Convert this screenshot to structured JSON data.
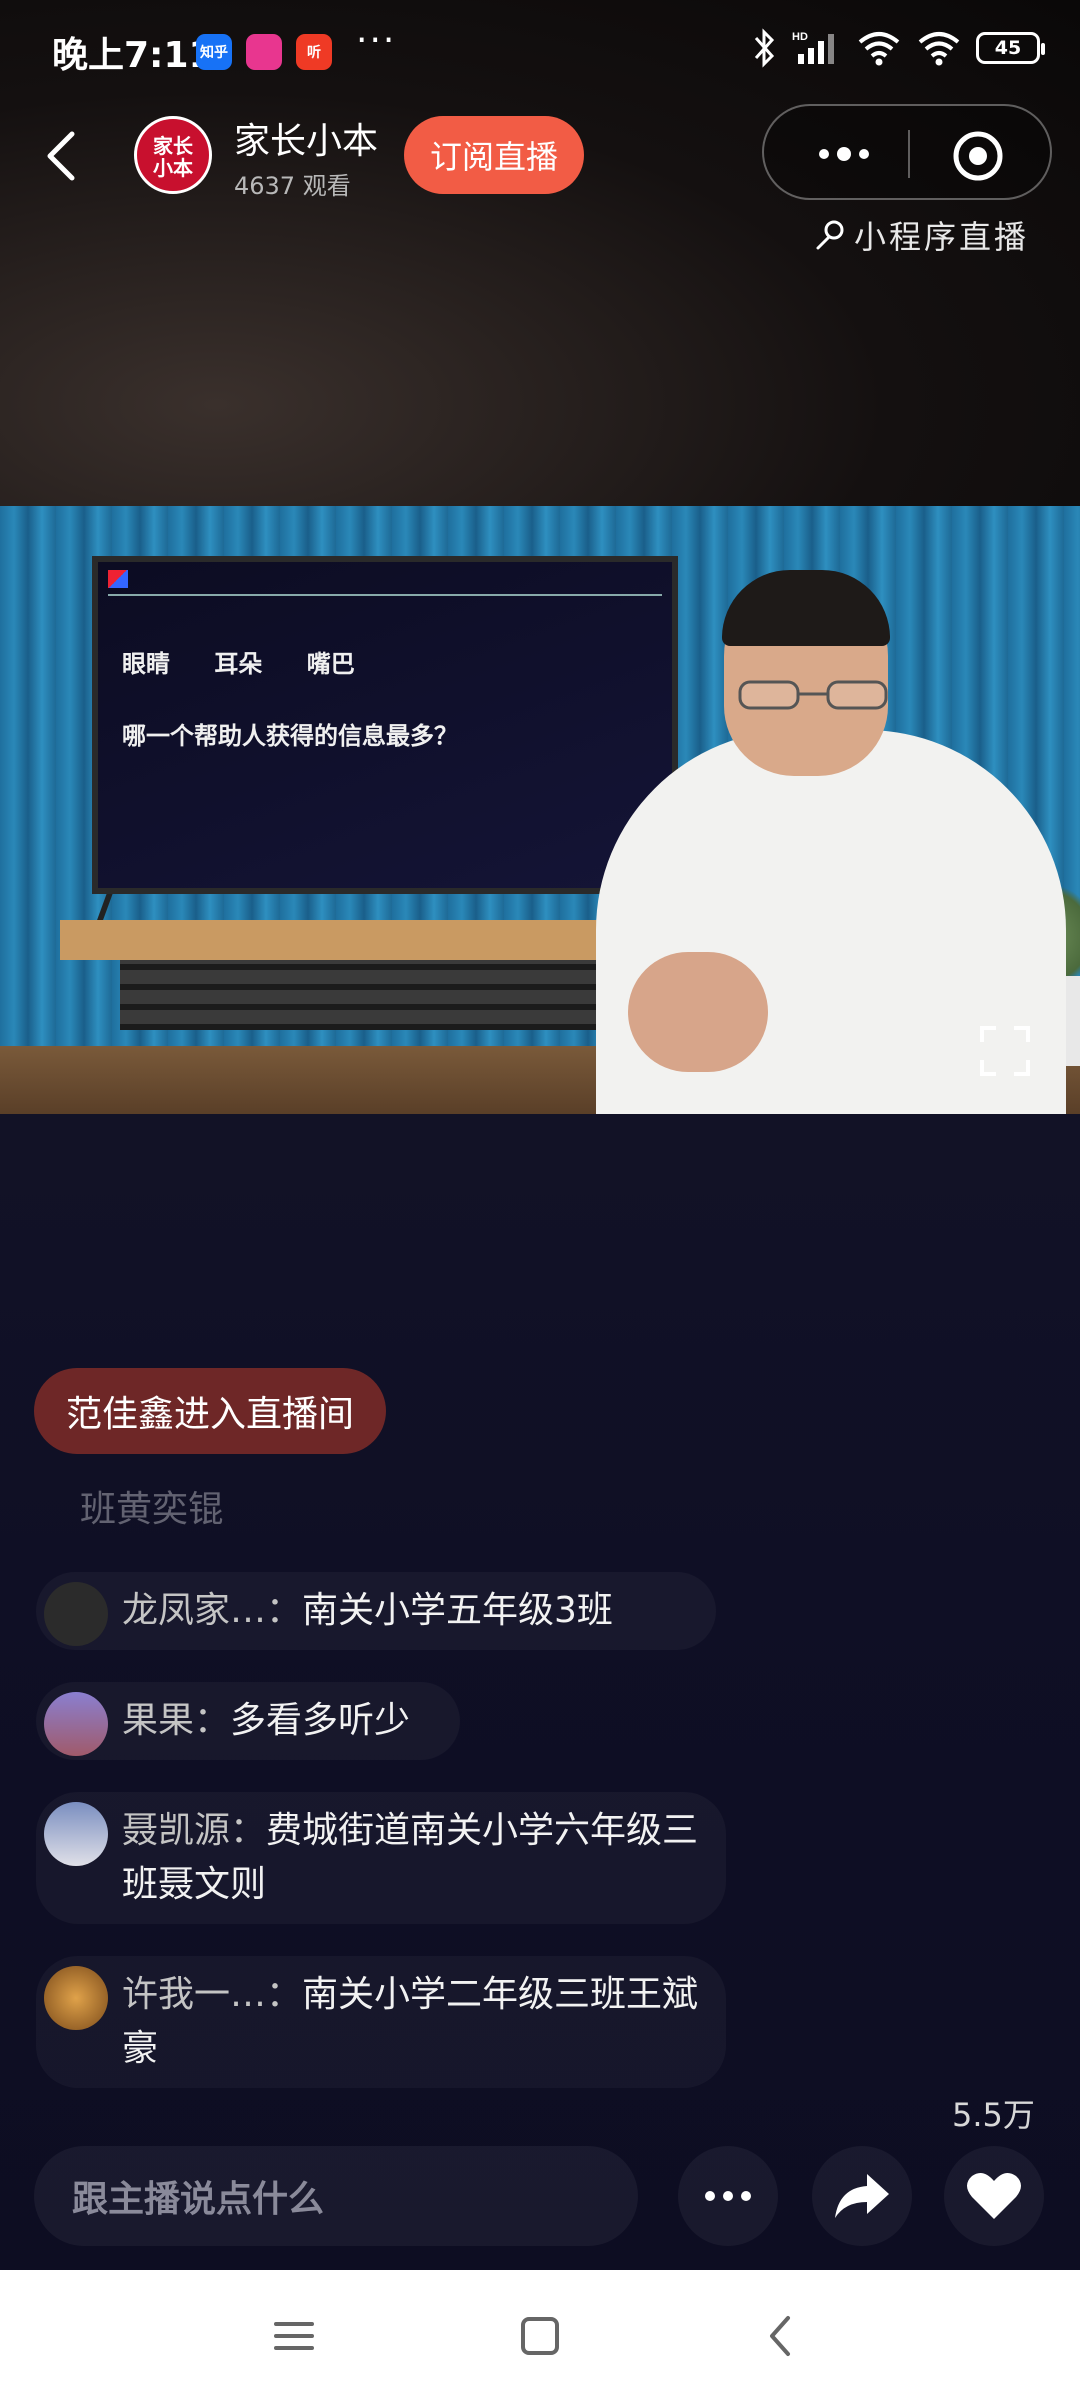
{
  "status_bar": {
    "time": "晚上7:11",
    "apps": [
      "知乎",
      "",
      "听"
    ],
    "more": "···",
    "battery": "45"
  },
  "header": {
    "logo_text": "家长\n小本",
    "channel_name": "家长小本",
    "viewers": "4637 观看",
    "subscribe_label": "订阅直播",
    "mini_live_label": "小程序直播"
  },
  "video": {
    "words": "眼睛 耳朵 嘴巴",
    "question": "哪一个帮助人获得的信息最多？"
  },
  "chat": {
    "join_notice": "范佳鑫进入直播间",
    "faded_line": "班黄奕锟",
    "messages": [
      {
        "name": "龙凤家…",
        "sep": "：",
        "text": "南关小学五年级3班",
        "avatar_color": "#2b2b2b"
      },
      {
        "name": "果果",
        "sep": "：",
        "text": "多看多听少",
        "avatar_color": "#6a5fa8"
      },
      {
        "name": "聂凯源",
        "sep": "：",
        "text": "费城街道南关小学六年级三班聂文则",
        "avatar_color": "#5a6e9a"
      },
      {
        "name": "许我一…",
        "sep": "：",
        "text": "南关小学二年级三班王斌豪",
        "avatar_color": "#c58a2e"
      }
    ]
  },
  "likes": "5.5万",
  "input": {
    "placeholder": "跟主播说点什么"
  },
  "colors": {
    "accent": "#f25c45",
    "join_pill": "#6e2727",
    "logo_red": "#c8102e"
  }
}
